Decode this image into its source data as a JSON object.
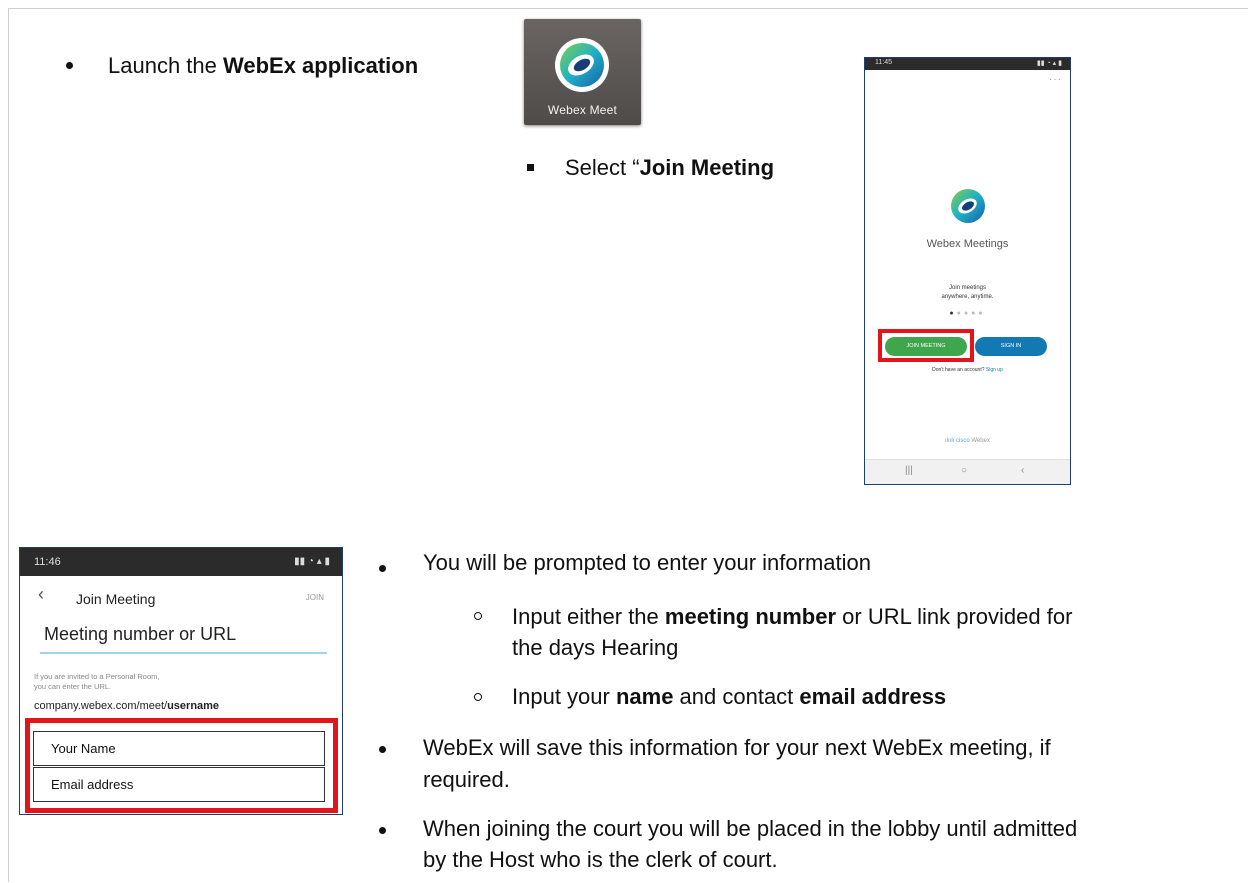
{
  "step1": {
    "text": "Launch the ",
    "bold": "WebEx application"
  },
  "app_icon": {
    "label": "Webex Meet",
    "icon": "webex-logo-icon"
  },
  "step2": {
    "text": "Select “",
    "bold": "Join Meeting"
  },
  "phone1": {
    "status_time": "11:45",
    "menu": "···",
    "app_title": "Webex Meetings",
    "tagline_line1": "Join meetings",
    "tagline_line2": "anywhere, anytime.",
    "join_button": "JOIN MEETING",
    "sign_in_button": "SIGN IN",
    "no_account": "Don't have an account?",
    "sign_up": "Sign up",
    "brand_footer": "Webex",
    "nav_recent": "|||",
    "nav_home": "○",
    "nav_back": "‹"
  },
  "phone2": {
    "status_time": "11:46",
    "back": "‹",
    "title": "Join Meeting",
    "join": "JOIN",
    "meeting_field": "Meeting number or URL",
    "hint_line1": "If you are invited to a Personal Room,",
    "hint_line2": "you can enter the URL.",
    "url_prefix": "company.webex.com/meet/",
    "url_bold": "username",
    "name_field": "Your Name",
    "email_field": "Email address"
  },
  "bullets": {
    "prompted": "You will be prompted to enter your information",
    "sub1_a": "Input either the ",
    "sub1_bold": "meeting number",
    "sub1_b": " or URL link provided for",
    "sub1_c": "the days Hearing",
    "sub2_a": "Input your ",
    "sub2_bold1": "name",
    "sub2_b": " and contact ",
    "sub2_bold2": "email address",
    "save_line1": "WebEx will save this information for your next WebEx meeting, if",
    "save_line2": "required.",
    "lobby_line1": "When joining the court you will be placed in the lobby until admitted",
    "lobby_line2": "by the Host who is the clerk of court."
  },
  "colors": {
    "highlight": "#e4141b",
    "join_green": "#3fa64e",
    "signin_blue": "#1279b3",
    "frame_blue": "#1f3f74"
  }
}
